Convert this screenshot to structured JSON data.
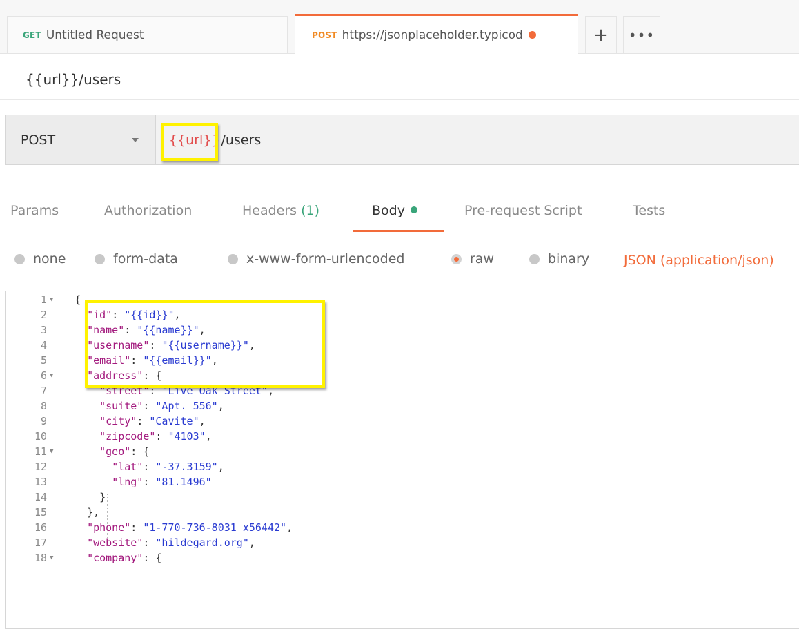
{
  "tabs": [
    {
      "method": "GET",
      "label": "Untitled Request"
    },
    {
      "method": "POST",
      "label": "https://jsonplaceholder.typicod"
    }
  ],
  "tab_actions": {
    "add": "+",
    "more": "•••"
  },
  "request_name": "{{url}}/users",
  "url_bar": {
    "method": "POST",
    "url_variable": "{{url}}",
    "url_path": "/users"
  },
  "request_tabs": [
    {
      "label": "Params"
    },
    {
      "label": "Authorization"
    },
    {
      "label": "Headers",
      "count": "(1)"
    },
    {
      "label": "Body"
    },
    {
      "label": "Pre-request Script"
    },
    {
      "label": "Tests"
    }
  ],
  "body_types": [
    "none",
    "form-data",
    "x-www-form-urlencoded",
    "raw",
    "binary"
  ],
  "selected_body_type": "raw",
  "content_type": "JSON (application/json)",
  "code_lines": [
    {
      "n": "1",
      "fold": true,
      "indent": "",
      "key": "",
      "val": "",
      "tail": "{"
    },
    {
      "n": "2",
      "fold": false,
      "indent": "  ",
      "key": "\"id\"",
      "val": "\"{{id}}\"",
      "tail": ","
    },
    {
      "n": "3",
      "fold": false,
      "indent": "  ",
      "key": "\"name\"",
      "val": "\"{{name}}\"",
      "tail": ","
    },
    {
      "n": "4",
      "fold": false,
      "indent": "  ",
      "key": "\"username\"",
      "val": "\"{{username}}\"",
      "tail": ","
    },
    {
      "n": "5",
      "fold": false,
      "indent": "  ",
      "key": "\"email\"",
      "val": "\"{{email}}\"",
      "tail": ","
    },
    {
      "n": "6",
      "fold": true,
      "indent": "  ",
      "key": "\"address\"",
      "val": "",
      "tail": "{"
    },
    {
      "n": "7",
      "fold": false,
      "indent": "    ",
      "key": "\"street\"",
      "val": "\"Live Oak Street\"",
      "tail": ","
    },
    {
      "n": "8",
      "fold": false,
      "indent": "    ",
      "key": "\"suite\"",
      "val": "\"Apt. 556\"",
      "tail": ","
    },
    {
      "n": "9",
      "fold": false,
      "indent": "    ",
      "key": "\"city\"",
      "val": "\"Cavite\"",
      "tail": ","
    },
    {
      "n": "10",
      "fold": false,
      "indent": "    ",
      "key": "\"zipcode\"",
      "val": "\"4103\"",
      "tail": ","
    },
    {
      "n": "11",
      "fold": true,
      "indent": "    ",
      "key": "\"geo\"",
      "val": "",
      "tail": "{"
    },
    {
      "n": "12",
      "fold": false,
      "indent": "      ",
      "key": "\"lat\"",
      "val": "\"-37.3159\"",
      "tail": ","
    },
    {
      "n": "13",
      "fold": false,
      "indent": "      ",
      "key": "\"lng\"",
      "val": "\"81.1496\"",
      "tail": ""
    },
    {
      "n": "14",
      "fold": false,
      "indent": "    ",
      "key": "",
      "val": "",
      "tail": "}"
    },
    {
      "n": "15",
      "fold": false,
      "indent": "  ",
      "key": "",
      "val": "",
      "tail": "},"
    },
    {
      "n": "16",
      "fold": false,
      "indent": "  ",
      "key": "\"phone\"",
      "val": "\"1-770-736-8031 x56442\"",
      "tail": ","
    },
    {
      "n": "17",
      "fold": false,
      "indent": "  ",
      "key": "\"website\"",
      "val": "\"hildegard.org\"",
      "tail": ","
    },
    {
      "n": "18",
      "fold": true,
      "indent": "  ",
      "key": "\"company\"",
      "val": "",
      "tail": "{"
    }
  ],
  "colors": {
    "accent": "#f26b3a",
    "get": "#3aa57a",
    "post": "#f08a24",
    "highlight": "#fff200",
    "json_key": "#a31a7e",
    "json_string": "#2a3bd1"
  }
}
